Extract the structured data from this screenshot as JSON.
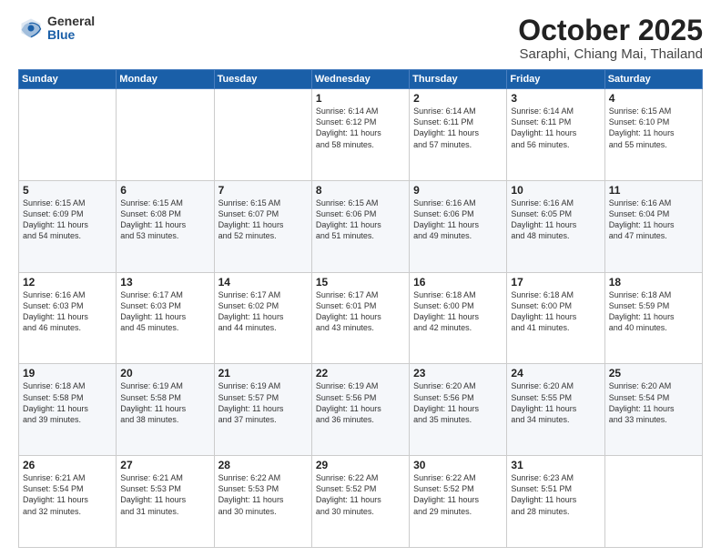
{
  "header": {
    "logo_general": "General",
    "logo_blue": "Blue",
    "title": "October 2025",
    "location": "Saraphi, Chiang Mai, Thailand"
  },
  "weekdays": [
    "Sunday",
    "Monday",
    "Tuesday",
    "Wednesday",
    "Thursday",
    "Friday",
    "Saturday"
  ],
  "weeks": [
    [
      {
        "day": "",
        "info": ""
      },
      {
        "day": "",
        "info": ""
      },
      {
        "day": "",
        "info": ""
      },
      {
        "day": "1",
        "info": "Sunrise: 6:14 AM\nSunset: 6:12 PM\nDaylight: 11 hours\nand 58 minutes."
      },
      {
        "day": "2",
        "info": "Sunrise: 6:14 AM\nSunset: 6:11 PM\nDaylight: 11 hours\nand 57 minutes."
      },
      {
        "day": "3",
        "info": "Sunrise: 6:14 AM\nSunset: 6:11 PM\nDaylight: 11 hours\nand 56 minutes."
      },
      {
        "day": "4",
        "info": "Sunrise: 6:15 AM\nSunset: 6:10 PM\nDaylight: 11 hours\nand 55 minutes."
      }
    ],
    [
      {
        "day": "5",
        "info": "Sunrise: 6:15 AM\nSunset: 6:09 PM\nDaylight: 11 hours\nand 54 minutes."
      },
      {
        "day": "6",
        "info": "Sunrise: 6:15 AM\nSunset: 6:08 PM\nDaylight: 11 hours\nand 53 minutes."
      },
      {
        "day": "7",
        "info": "Sunrise: 6:15 AM\nSunset: 6:07 PM\nDaylight: 11 hours\nand 52 minutes."
      },
      {
        "day": "8",
        "info": "Sunrise: 6:15 AM\nSunset: 6:06 PM\nDaylight: 11 hours\nand 51 minutes."
      },
      {
        "day": "9",
        "info": "Sunrise: 6:16 AM\nSunset: 6:06 PM\nDaylight: 11 hours\nand 49 minutes."
      },
      {
        "day": "10",
        "info": "Sunrise: 6:16 AM\nSunset: 6:05 PM\nDaylight: 11 hours\nand 48 minutes."
      },
      {
        "day": "11",
        "info": "Sunrise: 6:16 AM\nSunset: 6:04 PM\nDaylight: 11 hours\nand 47 minutes."
      }
    ],
    [
      {
        "day": "12",
        "info": "Sunrise: 6:16 AM\nSunset: 6:03 PM\nDaylight: 11 hours\nand 46 minutes."
      },
      {
        "day": "13",
        "info": "Sunrise: 6:17 AM\nSunset: 6:03 PM\nDaylight: 11 hours\nand 45 minutes."
      },
      {
        "day": "14",
        "info": "Sunrise: 6:17 AM\nSunset: 6:02 PM\nDaylight: 11 hours\nand 44 minutes."
      },
      {
        "day": "15",
        "info": "Sunrise: 6:17 AM\nSunset: 6:01 PM\nDaylight: 11 hours\nand 43 minutes."
      },
      {
        "day": "16",
        "info": "Sunrise: 6:18 AM\nSunset: 6:00 PM\nDaylight: 11 hours\nand 42 minutes."
      },
      {
        "day": "17",
        "info": "Sunrise: 6:18 AM\nSunset: 6:00 PM\nDaylight: 11 hours\nand 41 minutes."
      },
      {
        "day": "18",
        "info": "Sunrise: 6:18 AM\nSunset: 5:59 PM\nDaylight: 11 hours\nand 40 minutes."
      }
    ],
    [
      {
        "day": "19",
        "info": "Sunrise: 6:18 AM\nSunset: 5:58 PM\nDaylight: 11 hours\nand 39 minutes."
      },
      {
        "day": "20",
        "info": "Sunrise: 6:19 AM\nSunset: 5:58 PM\nDaylight: 11 hours\nand 38 minutes."
      },
      {
        "day": "21",
        "info": "Sunrise: 6:19 AM\nSunset: 5:57 PM\nDaylight: 11 hours\nand 37 minutes."
      },
      {
        "day": "22",
        "info": "Sunrise: 6:19 AM\nSunset: 5:56 PM\nDaylight: 11 hours\nand 36 minutes."
      },
      {
        "day": "23",
        "info": "Sunrise: 6:20 AM\nSunset: 5:56 PM\nDaylight: 11 hours\nand 35 minutes."
      },
      {
        "day": "24",
        "info": "Sunrise: 6:20 AM\nSunset: 5:55 PM\nDaylight: 11 hours\nand 34 minutes."
      },
      {
        "day": "25",
        "info": "Sunrise: 6:20 AM\nSunset: 5:54 PM\nDaylight: 11 hours\nand 33 minutes."
      }
    ],
    [
      {
        "day": "26",
        "info": "Sunrise: 6:21 AM\nSunset: 5:54 PM\nDaylight: 11 hours\nand 32 minutes."
      },
      {
        "day": "27",
        "info": "Sunrise: 6:21 AM\nSunset: 5:53 PM\nDaylight: 11 hours\nand 31 minutes."
      },
      {
        "day": "28",
        "info": "Sunrise: 6:22 AM\nSunset: 5:53 PM\nDaylight: 11 hours\nand 30 minutes."
      },
      {
        "day": "29",
        "info": "Sunrise: 6:22 AM\nSunset: 5:52 PM\nDaylight: 11 hours\nand 30 minutes."
      },
      {
        "day": "30",
        "info": "Sunrise: 6:22 AM\nSunset: 5:52 PM\nDaylight: 11 hours\nand 29 minutes."
      },
      {
        "day": "31",
        "info": "Sunrise: 6:23 AM\nSunset: 5:51 PM\nDaylight: 11 hours\nand 28 minutes."
      },
      {
        "day": "",
        "info": ""
      }
    ]
  ]
}
